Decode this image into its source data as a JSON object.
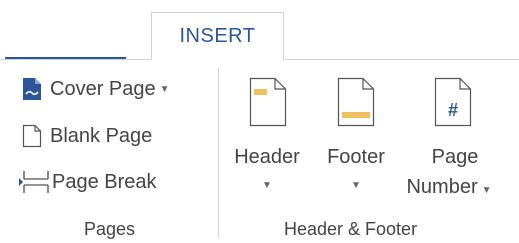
{
  "tabs": {
    "insert_label": "INSERT"
  },
  "pages_group": {
    "label": "Pages",
    "cover_page": "Cover Page",
    "blank_page": "Blank Page",
    "page_break": "Page Break"
  },
  "header_footer_group": {
    "label": "Header & Footer",
    "header": "Header",
    "footer": "Footer",
    "page_number_line1": "Page",
    "page_number_line2": "Number",
    "page_number_glyph": "#"
  },
  "icons": {
    "cover_page": "cover-page-icon",
    "blank_page": "blank-page-icon",
    "page_break": "page-break-icon",
    "header": "header-icon",
    "footer": "footer-icon",
    "page_number": "page-number-icon",
    "dropdown": "dropdown-arrow-icon"
  },
  "colors": {
    "accent": "#2b579a",
    "header_footer_fill": "#f0c060",
    "text": "#444444",
    "border": "#d4d4d4"
  }
}
